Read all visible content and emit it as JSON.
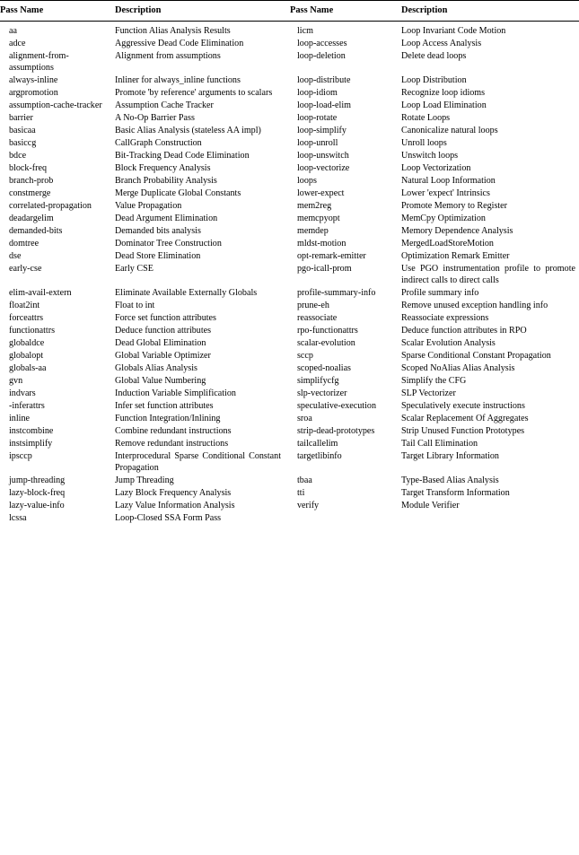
{
  "document": {
    "kind": "llvm-pass-reference-table",
    "columns": [
      "Pass Name",
      "Description",
      "Pass Name",
      "Description"
    ]
  },
  "table": {
    "headers": {
      "pass_name_left": "Pass Name",
      "description_left": "Description",
      "pass_name_right": "Pass Name",
      "description_right": "Description"
    },
    "rows": [
      {
        "l_name": "aa",
        "l_desc": "Function Alias Analysis Results",
        "r_name": "licm",
        "r_desc": "Loop Invariant Code Motion"
      },
      {
        "l_name": "adce",
        "l_desc": "Aggressive Dead Code Elimination",
        "r_name": "loop-accesses",
        "r_desc": "Loop Access Analysis"
      },
      {
        "l_name": "alignment-from-assumptions",
        "l_desc": "Alignment from assumptions",
        "r_name": "loop-deletion",
        "r_desc": "Delete dead loops"
      },
      {
        "l_name": "always-inline",
        "l_desc": "Inliner for always_inline functions",
        "r_name": "loop-distribute",
        "r_desc": "Loop Distribution"
      },
      {
        "l_name": "argpromotion",
        "l_desc": "Promote 'by reference' arguments to scalars",
        "r_name": "loop-idiom",
        "r_desc": "Recognize loop idioms"
      },
      {
        "l_name": "assumption-cache-tracker",
        "l_desc": "Assumption Cache Tracker",
        "r_name": "loop-load-elim",
        "r_desc": "Loop Load Elimination"
      },
      {
        "l_name": "barrier",
        "l_desc": "A No-Op Barrier Pass",
        "r_name": "loop-rotate",
        "r_desc": "Rotate Loops"
      },
      {
        "l_name": "basicaa",
        "l_desc": "Basic Alias Analysis (stateless AA impl)",
        "r_name": "loop-simplify",
        "r_desc": "Canonicalize natural loops"
      },
      {
        "l_name": "basiccg",
        "l_desc": "CallGraph Construction",
        "r_name": "loop-unroll",
        "r_desc": "Unroll loops"
      },
      {
        "l_name": "bdce",
        "l_desc": "Bit-Tracking Dead Code Elimination",
        "r_name": "loop-unswitch",
        "r_desc": "Unswitch loops"
      },
      {
        "l_name": "block-freq",
        "l_desc": "Block Frequency Analysis",
        "r_name": "loop-vectorize",
        "r_desc": "Loop Vectorization"
      },
      {
        "l_name": "branch-prob",
        "l_desc": "Branch Probability Analysis",
        "r_name": "loops",
        "r_desc": "Natural Loop Information"
      },
      {
        "l_name": "constmerge",
        "l_desc": "Merge Duplicate Global Constants",
        "r_name": "lower-expect",
        "r_desc": "Lower 'expect' Intrinsics"
      },
      {
        "l_name": "correlated-propagation",
        "l_desc": "Value Propagation",
        "r_name": "mem2reg",
        "r_desc": "Promote Memory to Register"
      },
      {
        "l_name": "deadargelim",
        "l_desc": "Dead Argument Elimination",
        "r_name": "memcpyopt",
        "r_desc": "MemCpy Optimization"
      },
      {
        "l_name": "demanded-bits",
        "l_desc": "Demanded bits analysis",
        "r_name": "memdep",
        "r_desc": "Memory Dependence Analysis"
      },
      {
        "l_name": "domtree",
        "l_desc": "Dominator Tree Construction",
        "r_name": "mldst-motion",
        "r_desc": "MergedLoadStoreMotion"
      },
      {
        "l_name": "dse",
        "l_desc": "Dead Store Elimination",
        "r_name": "opt-remark-emitter",
        "r_desc": "Optimization Remark Emitter"
      },
      {
        "l_name": "early-cse",
        "l_desc": "Early CSE",
        "r_name": "pgo-icall-prom",
        "r_desc": "Use PGO instrumentation profile to promote indirect calls to direct calls"
      },
      {
        "l_name": "elim-avail-extern",
        "l_desc": "Eliminate Available Externally Globals",
        "r_name": "profile-summary-info",
        "r_desc": "Profile summary info"
      },
      {
        "l_name": "float2int",
        "l_desc": "Float to int",
        "r_name": "prune-eh",
        "r_desc": "Remove unused exception handling info"
      },
      {
        "l_name": "forceattrs",
        "l_desc": "Force set function attributes",
        "r_name": "reassociate",
        "r_desc": "Reassociate expressions"
      },
      {
        "l_name": "functionattrs",
        "l_desc": "Deduce function attributes",
        "r_name": "rpo-functionattrs",
        "r_desc": "Deduce function attributes in RPO"
      },
      {
        "l_name": "globaldce",
        "l_desc": "Dead Global Elimination",
        "r_name": "scalar-evolution",
        "r_desc": "Scalar Evolution Analysis"
      },
      {
        "l_name": "globalopt",
        "l_desc": "Global Variable Optimizer",
        "r_name": "sccp",
        "r_desc": "Sparse Conditional Constant Propagation"
      },
      {
        "l_name": "globals-aa",
        "l_desc": "Globals Alias Analysis",
        "r_name": "scoped-noalias",
        "r_desc": "Scoped NoAlias Alias Analysis"
      },
      {
        "l_name": "gvn",
        "l_desc": "Global Value Numbering",
        "r_name": "simplifycfg",
        "r_desc": "Simplify the CFG"
      },
      {
        "l_name": "indvars",
        "l_desc": "Induction Variable Simplification",
        "r_name": "slp-vectorizer",
        "r_desc": "SLP Vectorizer"
      },
      {
        "l_name": "-inferattrs",
        "l_desc": "Infer set function attributes",
        "r_name": "speculative-execution",
        "r_desc": "Speculatively execute instructions"
      },
      {
        "l_name": "inline",
        "l_desc": "Function Integration/Inlining",
        "r_name": "sroa",
        "r_desc": "Scalar Replacement Of Aggregates"
      },
      {
        "l_name": "instcombine",
        "l_desc": "Combine redundant instructions",
        "r_name": "strip-dead-prototypes",
        "r_desc": "Strip Unused Function Prototypes"
      },
      {
        "l_name": "instsimplify",
        "l_desc": "Remove redundant instructions",
        "r_name": "tailcallelim",
        "r_desc": "Tail Call Elimination"
      },
      {
        "l_name": "ipsccp",
        "l_desc": "Interprocedural Sparse Conditional Constant Propagation",
        "r_name": "targetlibinfo",
        "r_desc": "Target Library Information"
      },
      {
        "l_name": "jump-threading",
        "l_desc": "Jump Threading",
        "r_name": "tbaa",
        "r_desc": "Type-Based Alias Analysis"
      },
      {
        "l_name": "lazy-block-freq",
        "l_desc": "Lazy Block Frequency Analysis",
        "r_name": "tti",
        "r_desc": "Target Transform Information"
      },
      {
        "l_name": "lazy-value-info",
        "l_desc": "Lazy Value Information Analysis",
        "r_name": "verify",
        "r_desc": "Module Verifier"
      },
      {
        "l_name": "lcssa",
        "l_desc": "Loop-Closed SSA Form Pass",
        "r_name": "",
        "r_desc": ""
      }
    ]
  }
}
